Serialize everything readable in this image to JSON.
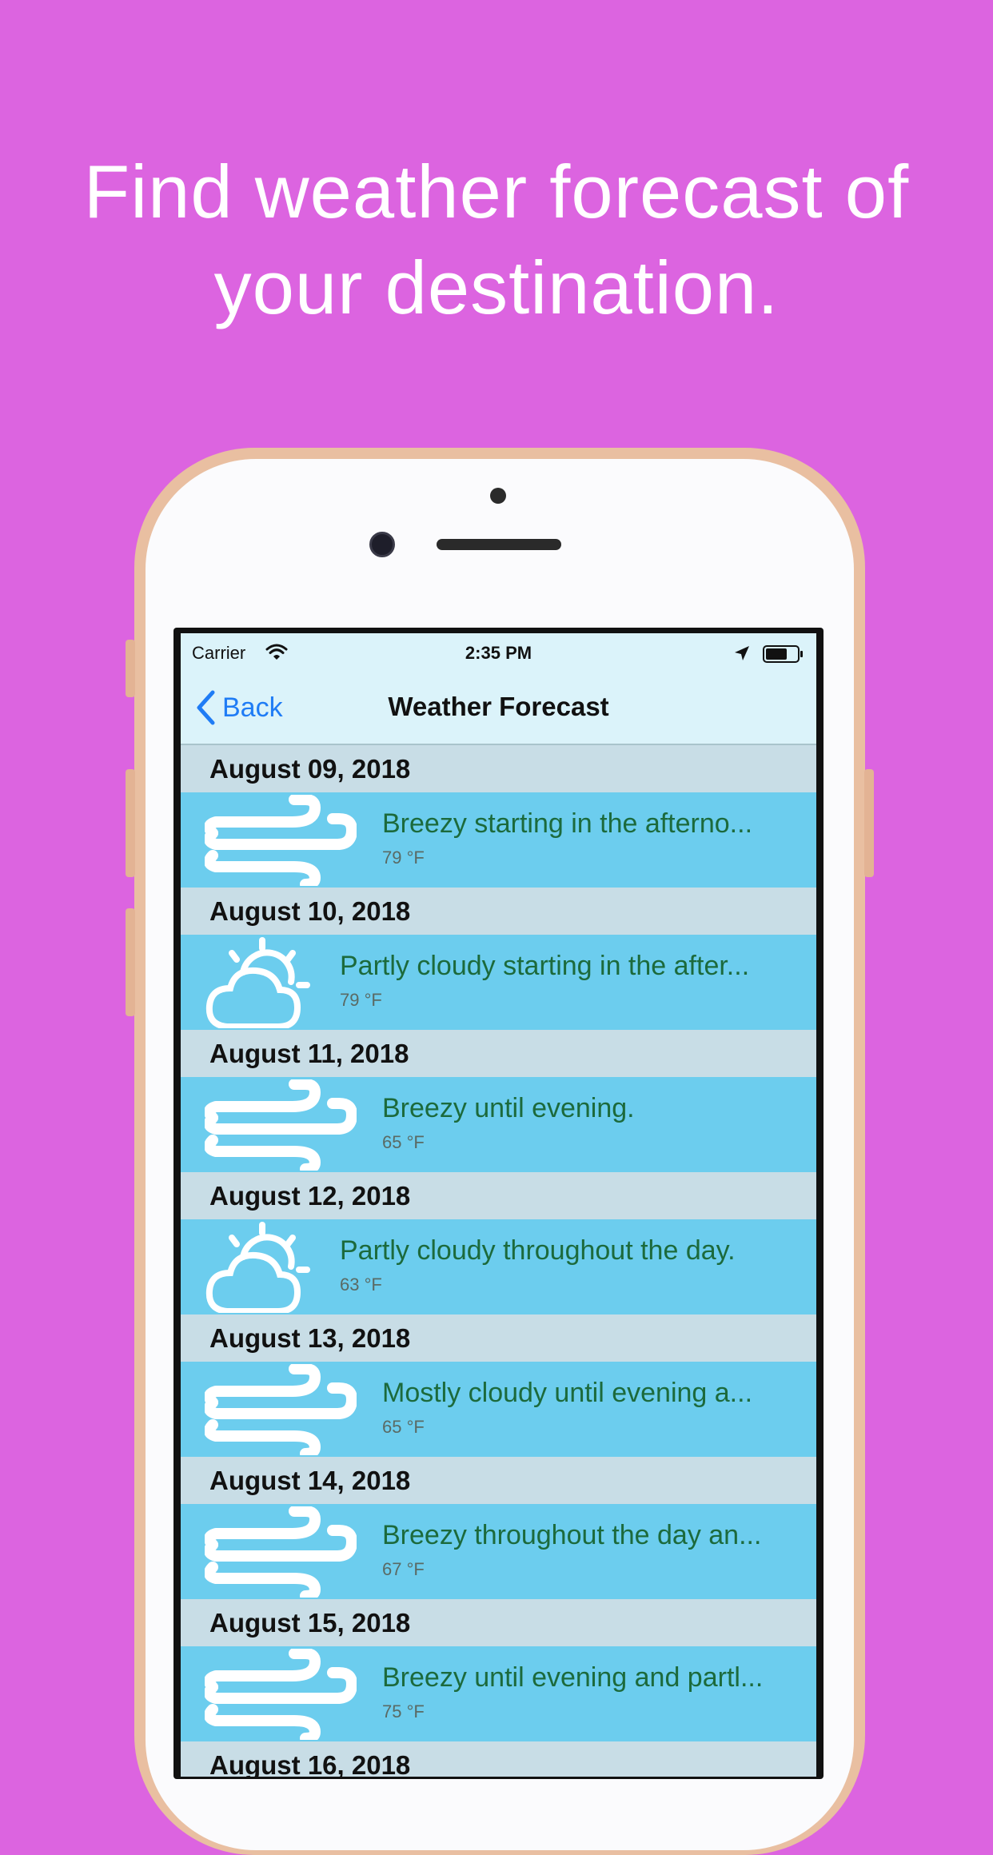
{
  "headline": {
    "line1": "Find weather forecast of",
    "line2": "your destination."
  },
  "status_bar": {
    "carrier": "Carrier",
    "time": "2:35 PM",
    "icons": [
      "wifi-icon",
      "location-arrow-icon",
      "battery-icon"
    ]
  },
  "nav": {
    "back_label": "Back",
    "title": "Weather Forecast"
  },
  "colors": {
    "background": "#dc64e0",
    "row": "#6ccdee",
    "section_header": "#c8dde6",
    "summary_text": "#1c6a3c",
    "back_link": "#1f7cf5"
  },
  "forecast": [
    {
      "date": "August 09, 2018",
      "icon": "wind-icon",
      "summary": "Breezy starting in the afterno...",
      "temp": "79 °F"
    },
    {
      "date": "August 10, 2018",
      "icon": "partly-cloudy-icon",
      "summary": "Partly cloudy starting in the after...",
      "temp": "79 °F"
    },
    {
      "date": "August 11, 2018",
      "icon": "wind-icon",
      "summary": "Breezy until evening.",
      "temp": "65 °F"
    },
    {
      "date": "August 12, 2018",
      "icon": "partly-cloudy-icon",
      "summary": "Partly cloudy throughout the day.",
      "temp": "63 °F"
    },
    {
      "date": "August 13, 2018",
      "icon": "wind-icon",
      "summary": "Mostly cloudy until evening a...",
      "temp": "65 °F"
    },
    {
      "date": "August 14, 2018",
      "icon": "wind-icon",
      "summary": "Breezy throughout the day an...",
      "temp": "67 °F"
    },
    {
      "date": "August 15, 2018",
      "icon": "wind-icon",
      "summary": "Breezy until evening and partl...",
      "temp": "75 °F"
    },
    {
      "date": "August 16, 2018"
    }
  ]
}
